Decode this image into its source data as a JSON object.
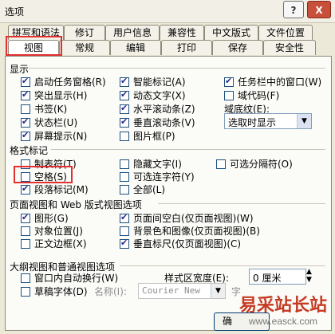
{
  "window": {
    "title": "选项",
    "help_label": "?",
    "close_label": "X"
  },
  "tabs_row1": [
    "拼写和语法",
    "修订",
    "用户信息",
    "兼容性",
    "中文版式",
    "文件位置"
  ],
  "tabs_row2": [
    "视图",
    "常规",
    "编辑",
    "打印",
    "保存",
    "安全性"
  ],
  "display": {
    "section_title": "显示",
    "items": [
      {
        "label": "启动任务窗格(R)",
        "checked": true
      },
      {
        "label": "智能标记(A)",
        "checked": true
      },
      {
        "label": "任务栏中的窗口(W)",
        "checked": true
      },
      {
        "label": "突出显示(H)",
        "checked": true
      },
      {
        "label": "动态文字(X)",
        "checked": true
      },
      {
        "label": "域代码(F)",
        "checked": false
      },
      {
        "label": "书签(K)",
        "checked": false
      },
      {
        "label": "水平滚动条(Z)",
        "checked": true
      },
      {
        "label": "状态栏(U)",
        "checked": true
      },
      {
        "label": "垂直滚动条(V)",
        "checked": true
      },
      {
        "label": "屏幕提示(N)",
        "checked": true
      },
      {
        "label": "图片框(P)",
        "checked": false
      }
    ],
    "field_shading_label": "域底纹(E):",
    "field_shading_value": "选取时显示"
  },
  "formatting": {
    "section_title": "格式标记",
    "items": [
      {
        "label": "制表符(T)",
        "checked": false
      },
      {
        "label": "隐藏文字(I)",
        "checked": false
      },
      {
        "label": "可选分隔符(O)",
        "checked": false
      },
      {
        "label": "空格(S)",
        "checked": false
      },
      {
        "label": "可选连字符(Y)",
        "checked": false
      },
      {
        "label": "段落标记(M)",
        "checked": true
      },
      {
        "label": "全部(L)",
        "checked": false
      }
    ]
  },
  "page_view": {
    "section_title": "页面视图和 Web 版式视图选项",
    "items": [
      {
        "label": "图形(G)",
        "checked": true
      },
      {
        "label": "页面间空白(仅页面视图)(W)",
        "checked": true
      },
      {
        "label": "对象位置(J)",
        "checked": false
      },
      {
        "label": "背景色和图像(仅页面视图)(B)",
        "checked": false
      },
      {
        "label": "正文边框(X)",
        "checked": false
      },
      {
        "label": "垂直标尺(仅页面视图)(C)",
        "checked": true
      }
    ]
  },
  "outline_view": {
    "section_title": "大纲视图和普通视图选项",
    "items": [
      {
        "label": "窗口内自动换行(W)",
        "checked": false
      },
      {
        "label": "草稿字体(D)",
        "checked": false
      }
    ],
    "style_area_label": "样式区宽度(E):",
    "style_area_value": "0 厘米",
    "name_label": "名称(I):",
    "font_value": "Courier New",
    "size_label": "字"
  },
  "ok_label": "确",
  "watermark": {
    "text": "易采站长站",
    "url": "www.easck.com"
  }
}
